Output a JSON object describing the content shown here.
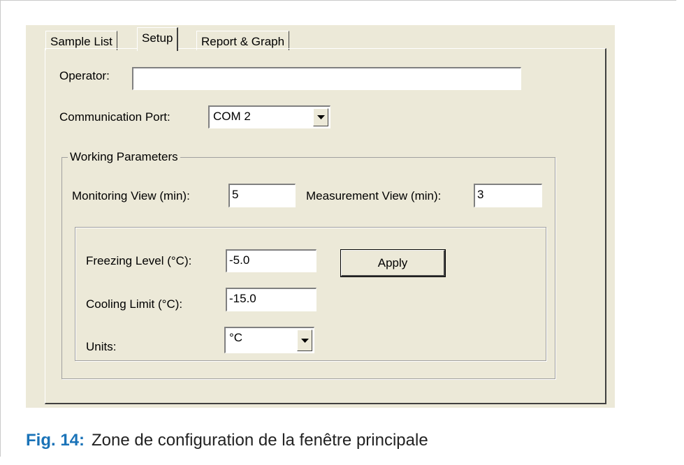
{
  "tabs": [
    {
      "label": "Sample List",
      "active": false
    },
    {
      "label": "Setup",
      "active": true
    },
    {
      "label": "Report & Graph",
      "active": false
    }
  ],
  "operator": {
    "label": "Operator:",
    "value": ""
  },
  "communication_port": {
    "label": "Communication Port:",
    "value": "COM 2"
  },
  "working_parameters": {
    "title": "Working Parameters",
    "monitoring_view": {
      "label": "Monitoring View (min):",
      "value": "5"
    },
    "measurement_view": {
      "label": "Measurement View (min):",
      "value": "3"
    },
    "freezing_level": {
      "label": "Freezing Level (°C):",
      "value": "-5.0"
    },
    "cooling_limit": {
      "label": "Cooling Limit (°C):",
      "value": "-15.0"
    },
    "units": {
      "label": "Units:",
      "value": "°C"
    },
    "apply_label": "Apply"
  },
  "caption": {
    "figure": "Fig. 14:",
    "text": "Zone de configuration de la fenêtre principale"
  },
  "colors": {
    "window_bg": "#ece9d8",
    "caption_accent": "#1a73b8"
  },
  "icons": {
    "dropdown": "chevron-down-icon"
  }
}
